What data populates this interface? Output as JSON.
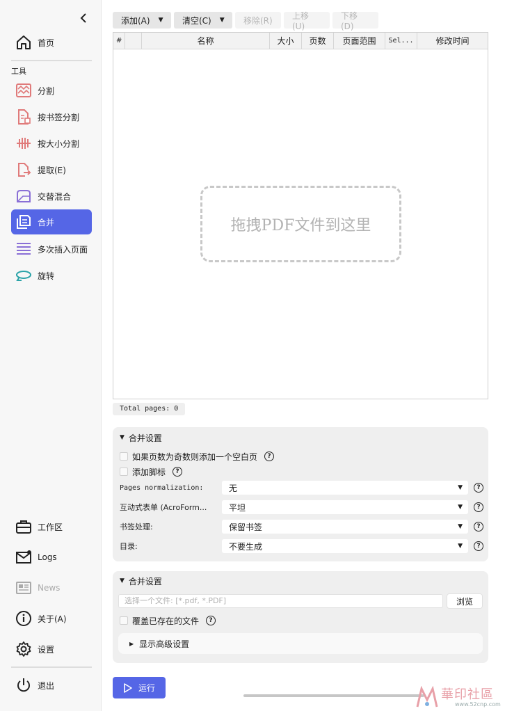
{
  "sidebar": {
    "home_label": "首页",
    "section_tools": "工具",
    "tools": [
      {
        "label": "分割",
        "icon": "split-icon"
      },
      {
        "label": "按书签分割",
        "icon": "bookmark-split-icon"
      },
      {
        "label": "按大小分割",
        "icon": "size-split-icon"
      },
      {
        "label": "提取(E)",
        "icon": "extract-icon"
      },
      {
        "label": "交替混合",
        "icon": "alternate-mix-icon"
      },
      {
        "label": "合并",
        "icon": "merge-icon"
      },
      {
        "label": "多次插入页面",
        "icon": "multi-insert-icon"
      },
      {
        "label": "旋转",
        "icon": "rotate-icon"
      }
    ],
    "active_tool": "合并",
    "bottom": [
      {
        "label": "工作区",
        "icon": "workspace-icon"
      },
      {
        "label": "Logs",
        "icon": "logs-icon"
      },
      {
        "label": "News",
        "icon": "news-icon"
      },
      {
        "label": "关于(A)",
        "icon": "info-icon"
      },
      {
        "label": "设置",
        "icon": "gear-icon"
      },
      {
        "label": "退出",
        "icon": "power-icon"
      }
    ]
  },
  "toolbar": {
    "add": "添加(A)",
    "clear": "清空(C)",
    "remove": "移除(R)",
    "move_up": "上移(U)",
    "move_down": "下移(D)"
  },
  "table": {
    "columns": [
      "#",
      "",
      "名称",
      "大小",
      "页数",
      "页面范围",
      "Sel...",
      "修改时间"
    ],
    "rows": [],
    "dropzone_text": "拖拽PDF文件到这里"
  },
  "total_pages": "Total pages: 0",
  "merge_settings": {
    "title": "合并设置",
    "blank_page_odd": "如果页数为奇数则添加一个空白页",
    "add_footer": "添加脚标",
    "settings": [
      {
        "label": "Pages normalization:",
        "value": "无"
      },
      {
        "label": "互动式表单 (AcroForm...",
        "value": "平坦"
      },
      {
        "label": "书签处理:",
        "value": "保留书签"
      },
      {
        "label": "目录:",
        "value": "不要生成"
      }
    ]
  },
  "output_settings": {
    "title": "合并设置",
    "file_placeholder": "选择一个文件: [*.pdf, *.PDF]",
    "browse": "浏览",
    "overwrite": "覆盖已存在的文件",
    "advanced": "显示高级设置"
  },
  "run_label": "运行",
  "watermark": {
    "text": "華印社區",
    "url": "www.52cnp.com"
  },
  "colors": {
    "accent": "#5566e6",
    "icon_red": "#e07a7a",
    "icon_purple": "#8a6fd6",
    "icon_teal": "#2ba3a8"
  }
}
